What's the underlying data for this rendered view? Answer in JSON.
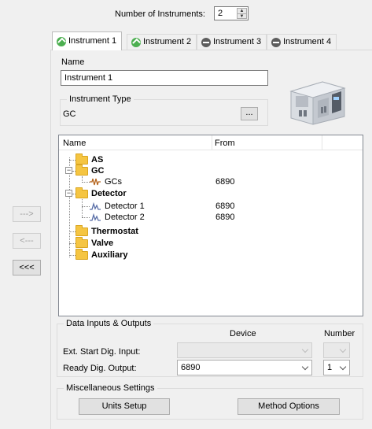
{
  "header": {
    "num_instruments_label": "Number of Instruments:",
    "num_instruments_value": "2"
  },
  "side_buttons": {
    "add": "--->",
    "remove": "<---",
    "remove_all": "<<<"
  },
  "tabs": [
    {
      "label": "Instrument 1",
      "status": "green-check-icon",
      "active": true
    },
    {
      "label": "Instrument 2",
      "status": "green-check-icon",
      "active": false
    },
    {
      "label": "Instrument 3",
      "status": "grey-minus-icon",
      "active": false
    },
    {
      "label": "Instrument 4",
      "status": "grey-minus-icon",
      "active": false
    }
  ],
  "instrument": {
    "name_label": "Name",
    "name_value": "Instrument 1",
    "type_group_title": "Instrument Type",
    "type_value": "GC",
    "type_button": "..."
  },
  "tree": {
    "col_name": "Name",
    "col_from": "From",
    "rows": [
      {
        "label": "AS",
        "from": "",
        "kind": "folder"
      },
      {
        "label": "GC",
        "from": "",
        "kind": "folder"
      },
      {
        "label": "GCs",
        "from": "6890",
        "kind": "leaf"
      },
      {
        "label": "Detector",
        "from": "",
        "kind": "folder"
      },
      {
        "label": "Detector 1",
        "from": "6890",
        "kind": "leaf"
      },
      {
        "label": "Detector 2",
        "from": "6890",
        "kind": "leaf"
      },
      {
        "label": "Thermostat",
        "from": "",
        "kind": "folder"
      },
      {
        "label": "Valve",
        "from": "",
        "kind": "folder"
      },
      {
        "label": "Auxiliary",
        "from": "",
        "kind": "folder"
      }
    ]
  },
  "data_io": {
    "group_title": "Data Inputs & Outputs",
    "col_device": "Device",
    "col_number": "Number",
    "ext_start_label": "Ext. Start Dig. Input:",
    "ext_start_device": "",
    "ext_start_number": "",
    "ready_label": "Ready Dig. Output:",
    "ready_device": "6890",
    "ready_number": "1"
  },
  "misc": {
    "group_title": "Miscellaneous Settings",
    "units_button": "Units Setup",
    "method_button": "Method Options"
  }
}
